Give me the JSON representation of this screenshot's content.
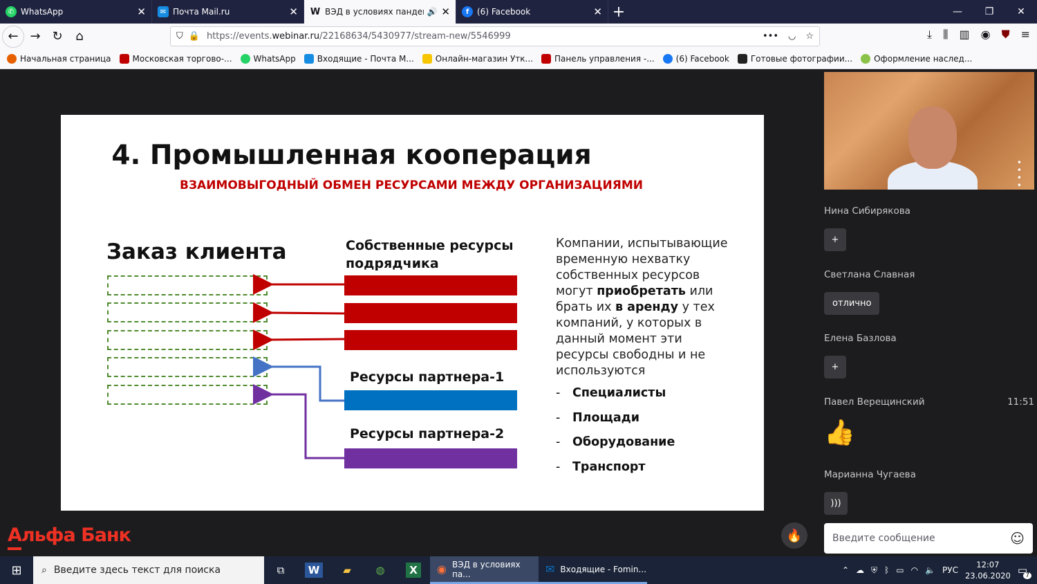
{
  "tabs": [
    {
      "title": "WhatsApp",
      "icon": "whatsapp-icon",
      "color": "#25d366"
    },
    {
      "title": "Почта Mail.ru",
      "icon": "mail-icon",
      "color": "#168de2"
    },
    {
      "title": "ВЭД в условиях пандемии",
      "icon": "webinar-icon",
      "color": "#15141a"
    },
    {
      "title": "(6) Facebook",
      "icon": "facebook-icon",
      "color": "#1877f2"
    }
  ],
  "url": {
    "prefix": "https://events.",
    "host": "webinar.ru",
    "path": "/22168634/5430977/stream-new/5546999"
  },
  "bookmarks": [
    {
      "label": "Начальная страница",
      "color": "#e66000"
    },
    {
      "label": "Московская торгово-...",
      "color": "#c00000"
    },
    {
      "label": "WhatsApp",
      "color": "#25d366"
    },
    {
      "label": "Входящие - Почта М...",
      "color": "#168de2"
    },
    {
      "label": "Онлайн-магазин Утк...",
      "color": "#f7c600"
    },
    {
      "label": "Панель управления -...",
      "color": "#c00000"
    },
    {
      "label": "(6) Facebook",
      "color": "#1877f2"
    },
    {
      "label": "Готовые фотографии...",
      "color": "#222222"
    },
    {
      "label": "Оформление наслед...",
      "color": "#8bc34a"
    }
  ],
  "slide": {
    "title": "4. Промышленная кооперация",
    "subtitle": "ВЗАИМОВЫГОДНЫЙ ОБМЕН РЕСУРСАМИ МЕЖДУ ОРГАНИЗАЦИЯМИ",
    "order_title": "Заказ клиента",
    "own_title_1": "Собственные ресурсы",
    "own_title_2": "подрядчика",
    "partner1": "Ресурсы партнера-1",
    "partner2": "Ресурсы партнера-2",
    "desc": {
      "p1": "Компании, испытывающие временную нехватку собственных ресурсов могут ",
      "b1": "приобретать",
      "p2": " или брать их ",
      "b2": "в аренду",
      "p3": " у тех компаний, у которых в данный момент эти ресурсы свободны и не используются"
    },
    "list": [
      "Специалисты",
      "Площади",
      "Оборудование",
      "Транспорт"
    ],
    "colors": {
      "red": "#c00000",
      "blue": "#0070c0",
      "purple": "#7030a0",
      "green": "#4e8a2e"
    }
  },
  "brand": "Альфа Банк",
  "chat": [
    {
      "name": "Нина Сибирякова",
      "msg": "+",
      "time": ""
    },
    {
      "name": "Светлана Славная",
      "msg": "отлично",
      "time": ""
    },
    {
      "name": "Елена Базлова",
      "msg": "+",
      "time": ""
    },
    {
      "name": "Павел Верещинский",
      "msg": "👍",
      "time": "11:51"
    },
    {
      "name": "Марианна Чугаева",
      "msg": ")))",
      "time": ""
    }
  ],
  "message_placeholder": "Введите сообщение",
  "taskbar": {
    "search_placeholder": "Введите здесь текст для поиска",
    "app1": "ВЭД в условиях па...",
    "app2": "Входящие - Fomin...",
    "lang": "РУС",
    "time": "12:07",
    "date": "23.06.2020",
    "notif_count": "7"
  }
}
